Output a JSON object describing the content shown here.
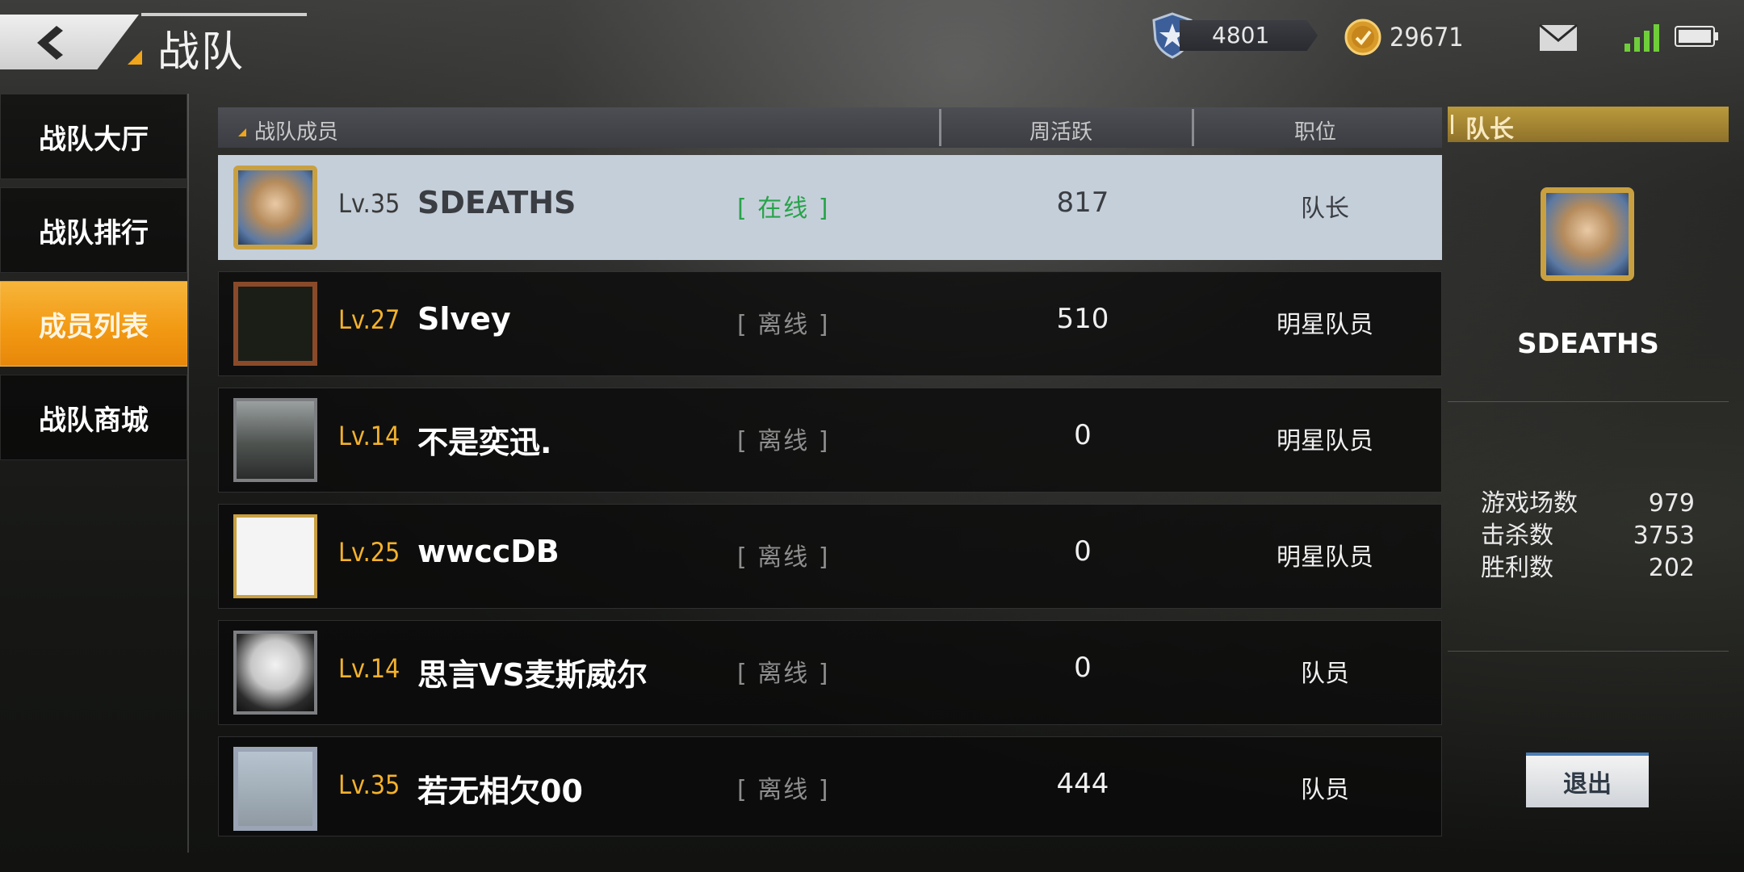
{
  "header": {
    "title": "战队",
    "currency_1": {
      "icon": "shield-star-icon",
      "value": "4801"
    },
    "currency_2": {
      "icon": "gold-coin-icon",
      "value": "29671"
    }
  },
  "nav": {
    "items": [
      {
        "label": "战队大厅",
        "active": false
      },
      {
        "label": "战队排行",
        "active": false
      },
      {
        "label": "成员列表",
        "active": true
      },
      {
        "label": "战队商城",
        "active": false
      }
    ]
  },
  "table": {
    "headers": {
      "members": "战队成员",
      "weekly_activity": "周活跃",
      "position": "职位"
    },
    "rows": [
      {
        "level": "Lv.35",
        "name": "SDEATHS",
        "status": "[ 在线 ]",
        "activity": "817",
        "position": "队长",
        "selected": true
      },
      {
        "level": "Lv.27",
        "name": "Slvey",
        "status": "[ 离线 ]",
        "activity": "510",
        "position": "明星队员",
        "selected": false
      },
      {
        "level": "Lv.14",
        "name": "不是奕迅.",
        "status": "[ 离线 ]",
        "activity": "0",
        "position": "明星队员",
        "selected": false
      },
      {
        "level": "Lv.25",
        "name": "wwccDB",
        "status": "[ 离线 ]",
        "activity": "0",
        "position": "明星队员",
        "selected": false
      },
      {
        "level": "Lv.14",
        "name": "思言VS麦斯威尔",
        "status": "[ 离线 ]",
        "activity": "0",
        "position": "队员",
        "selected": false
      },
      {
        "level": "Lv.35",
        "name": "若无相欠00",
        "status": "[ 离线 ]",
        "activity": "444",
        "position": "队员",
        "selected": false
      }
    ]
  },
  "captain": {
    "header": "队长",
    "name": "SDEATHS",
    "stats": [
      {
        "label": "游戏场数",
        "value": "979"
      },
      {
        "label": "击杀数",
        "value": "3753"
      },
      {
        "label": "胜利数",
        "value": "202"
      }
    ],
    "exit_label": "退出"
  },
  "colors": {
    "accent_orange": "#f29a14",
    "online_green": "#28a34a",
    "level_gold": "#f4b22c",
    "captain_gold": "#bb9a3c",
    "selected_row": "#c5cfda"
  }
}
